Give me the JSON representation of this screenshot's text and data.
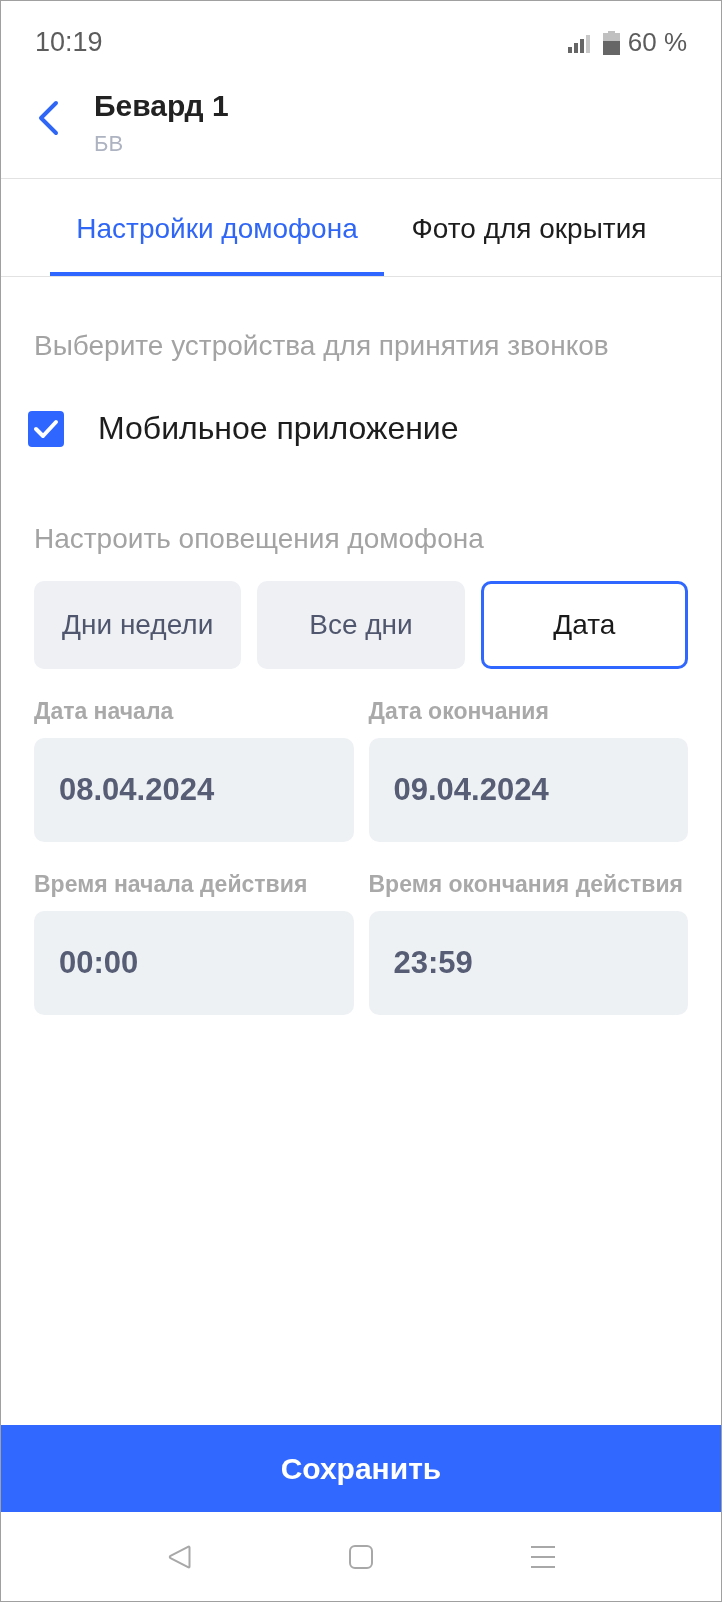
{
  "status_bar": {
    "time": "10:19",
    "battery_text": "60 %"
  },
  "header": {
    "title": "Бевард 1",
    "subtitle": "БВ"
  },
  "tabs": [
    {
      "label": "Настройки домофона",
      "selected": true
    },
    {
      "label": "Фото для окрытия",
      "selected": false
    }
  ],
  "devices": {
    "heading": "Выберите устройства для принятия звонков",
    "options": [
      {
        "label": "Мобильное приложение",
        "checked": true
      }
    ]
  },
  "notifications": {
    "heading": "Настроить оповещения домофона",
    "modes": [
      {
        "label": "Дни недели",
        "selected": false
      },
      {
        "label": "Все дни",
        "selected": false
      },
      {
        "label": "Дата",
        "selected": true
      }
    ],
    "fields": [
      {
        "label": "Дата начала",
        "value": "08.04.2024"
      },
      {
        "label": "Дата окончания",
        "value": "09.04.2024"
      },
      {
        "label": "Время начала действия",
        "value": "00:00"
      },
      {
        "label": "Время окончания действия",
        "value": "23:59"
      }
    ]
  },
  "save_button": "Сохранить"
}
